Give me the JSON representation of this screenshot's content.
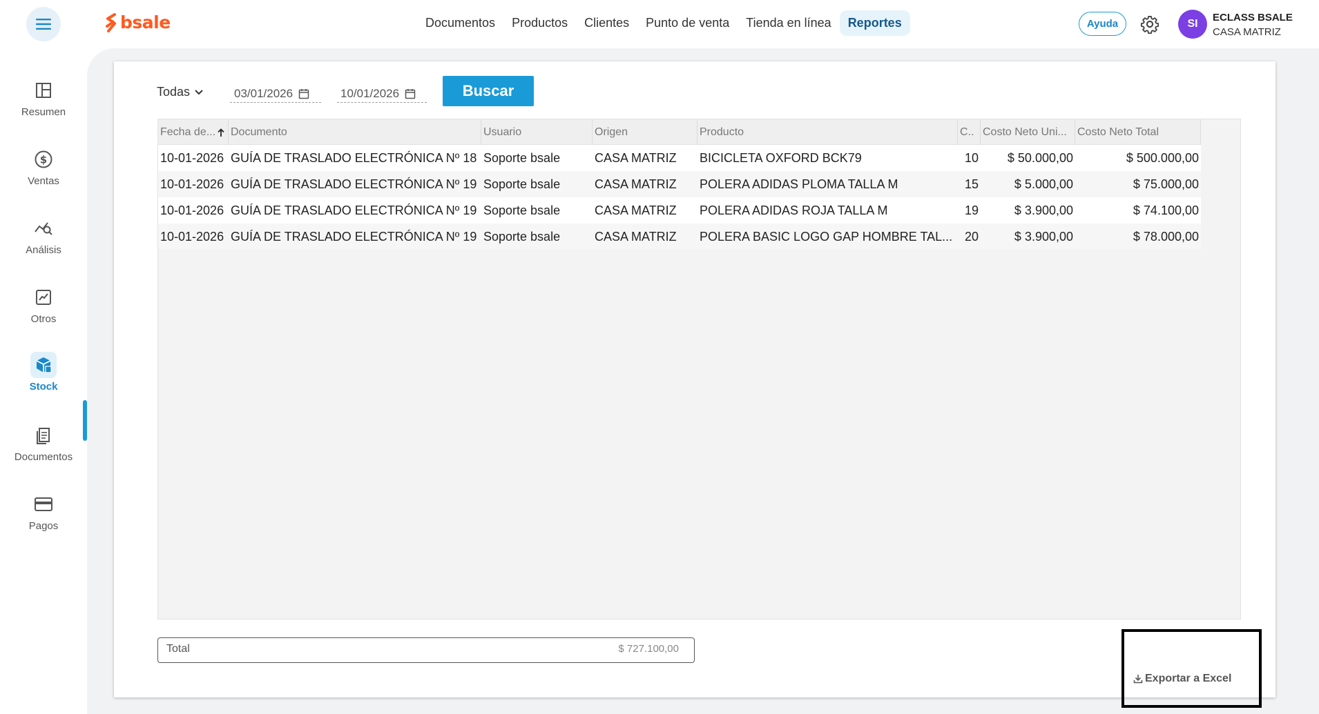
{
  "header": {
    "logo_text": "bsale",
    "nav": [
      "Documentos",
      "Productos",
      "Clientes",
      "Punto de venta",
      "Tienda en línea",
      "Reportes"
    ],
    "active_nav": "Reportes",
    "help_label": "Ayuda",
    "avatar_initials": "SI",
    "user_name": "ECLASS BSALE",
    "user_branch": "CASA MATRIZ"
  },
  "sidebar": {
    "items": [
      {
        "label": "Resumen",
        "icon": "layout-icon"
      },
      {
        "label": "Ventas",
        "icon": "dollar-icon"
      },
      {
        "label": "Análisis",
        "icon": "analysis-icon"
      },
      {
        "label": "Otros",
        "icon": "chart-icon"
      },
      {
        "label": "Stock",
        "icon": "box-icon"
      },
      {
        "label": "Documentos",
        "icon": "documents-icon"
      },
      {
        "label": "Pagos",
        "icon": "card-icon"
      }
    ],
    "active": "Stock"
  },
  "filters": {
    "type_select": "Todas",
    "date_from": "03/01/2026",
    "date_to": "10/01/2026",
    "search_label": "Buscar"
  },
  "table": {
    "columns": [
      "Fecha de...",
      "Documento",
      "Usuario",
      "Origen",
      "Producto",
      "C..",
      "Costo Neto Uni...",
      "Costo Neto Total"
    ],
    "rows": [
      [
        "10-01-2026",
        "GUÍA DE TRASLADO ELECTRÓNICA Nº 18",
        "Soporte bsale",
        "CASA MATRIZ",
        "BICICLETA OXFORD BCK79",
        "10",
        "$ 50.000,00",
        "$ 500.000,00"
      ],
      [
        "10-01-2026",
        "GUÍA DE TRASLADO ELECTRÓNICA Nº 19",
        "Soporte bsale",
        "CASA MATRIZ",
        "POLERA ADIDAS PLOMA TALLA M",
        "15",
        "$ 5.000,00",
        "$ 75.000,00"
      ],
      [
        "10-01-2026",
        "GUÍA DE TRASLADO ELECTRÓNICA Nº 19",
        "Soporte bsale",
        "CASA MATRIZ",
        "POLERA ADIDAS ROJA TALLA M",
        "19",
        "$ 3.900,00",
        "$ 74.100,00"
      ],
      [
        "10-01-2026",
        "GUÍA DE TRASLADO ELECTRÓNICA Nº 19",
        "Soporte bsale",
        "CASA MATRIZ",
        "POLERA BASIC LOGO GAP HOMBRE TAL...",
        "20",
        "$ 3.900,00",
        "$ 78.000,00"
      ]
    ]
  },
  "footer": {
    "total_label": "Total",
    "total_value": "$ 727.100,00",
    "export_label": "Exportar a Excel"
  },
  "colors": {
    "brand": "#ff5a1f",
    "accent": "#1a9bd7",
    "avatar": "#7b3fe4"
  }
}
